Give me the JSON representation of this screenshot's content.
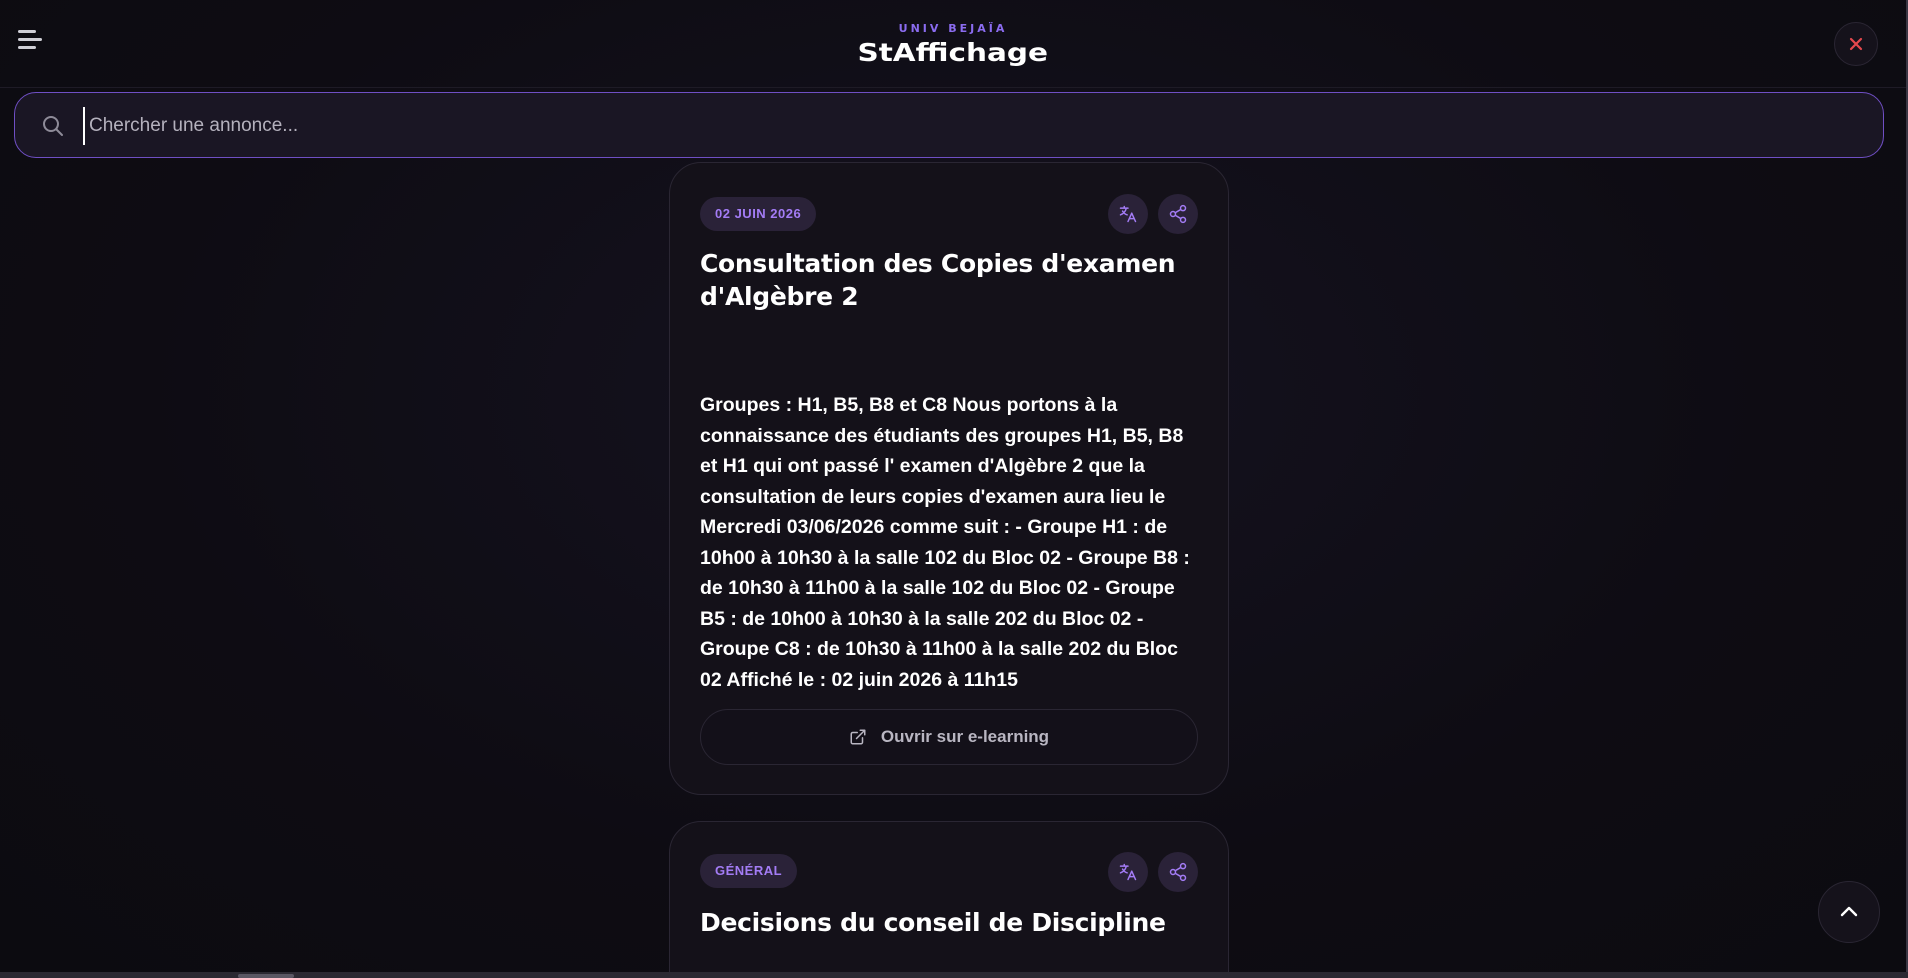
{
  "header": {
    "brand_sub": "UNIV BEJAÏA",
    "brand_title": "StAffichage",
    "menu_icon": "hamburger-menu-icon",
    "close_icon": "close-icon",
    "close_color": "#e5484d"
  },
  "search": {
    "placeholder": "Chercher une annonce...",
    "value": "",
    "icon": "search-icon"
  },
  "announcements": [
    {
      "tag": "02 JUIN 2026",
      "title": "Consultation des Copies d'examen d'Algèbre 2",
      "body": "Groupes : H1, B5, B8 et C8 Nous portons à la connaissance des étudiants des groupes H1, B5, B8 et H1 qui ont passé l' examen d'Algèbre 2 que la consultation de leurs copies d'examen aura lieu le Mercredi 03/06/2026 comme suit : - Groupe H1 : de 10h00 à 10h30 à la salle 102 du Bloc 02 - Groupe  B8 : de 10h30 à 11h00 à la salle 102 du Bloc 02 - Groupe B5 : de 10h00 à 10h30 à la salle 202 du Bloc 02 - Groupe C8 : de 10h30 à 11h00 à la salle 202 du Bloc 02 Affiché le : 02 juin 2026 à 11h15",
      "link_label": "Ouvrir sur e-learning",
      "icons": [
        "translate-icon",
        "share-icon",
        "external-link-icon"
      ]
    },
    {
      "tag": "GÉNÉRAL",
      "title": "Decisions du conseil de Discipline",
      "icons": [
        "translate-icon",
        "share-icon"
      ]
    }
  ],
  "scroll_top_icon": "chevron-up-icon",
  "colors": {
    "accent": "#8b6cf0",
    "tag_text": "#a37cf5",
    "tag_bg": "#2a2238",
    "search_border": "#6f4fc4",
    "background": "#0f0d14"
  }
}
